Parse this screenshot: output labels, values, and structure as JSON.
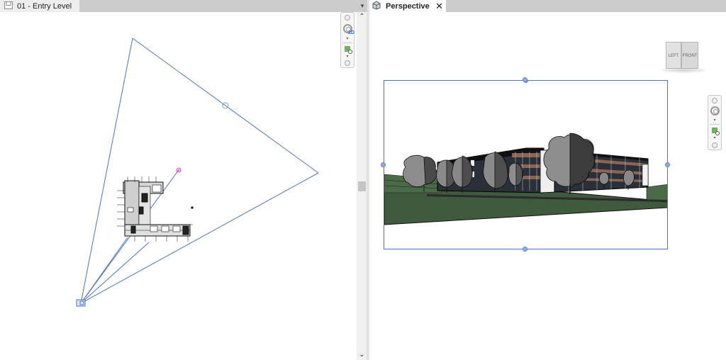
{
  "left_view": {
    "tab_label": "01 - Entry Level",
    "tab_icon": "floor-plan-icon",
    "pane_menu_icon": "dropdown-list-icon",
    "navbar": {
      "wheel_label": "2D",
      "items": [
        "2d-steering-wheel",
        "zoom-region"
      ]
    },
    "scrollbar": {
      "up_icon": "chevron-up-icon",
      "down_icon": "chevron-down-icon",
      "up_glyph": "⌃",
      "down_glyph": "⌄"
    }
  },
  "right_view": {
    "tab_label": "Perspective",
    "tab_icon": "3d-view-icon",
    "close_glyph": "✕",
    "viewcube": {
      "left_face": "LEFT",
      "front_face": "FRONT"
    },
    "navbar": {
      "items": [
        "full-steering-wheel",
        "zoom-region"
      ]
    }
  },
  "colors": {
    "camera_line": "#4a74c9",
    "target_marker": "#e040c8",
    "grass": "#3f5a3c",
    "tab_bar": "#cccccc"
  },
  "glyphs": {
    "caret": "▾",
    "pane_menu": "▾"
  }
}
